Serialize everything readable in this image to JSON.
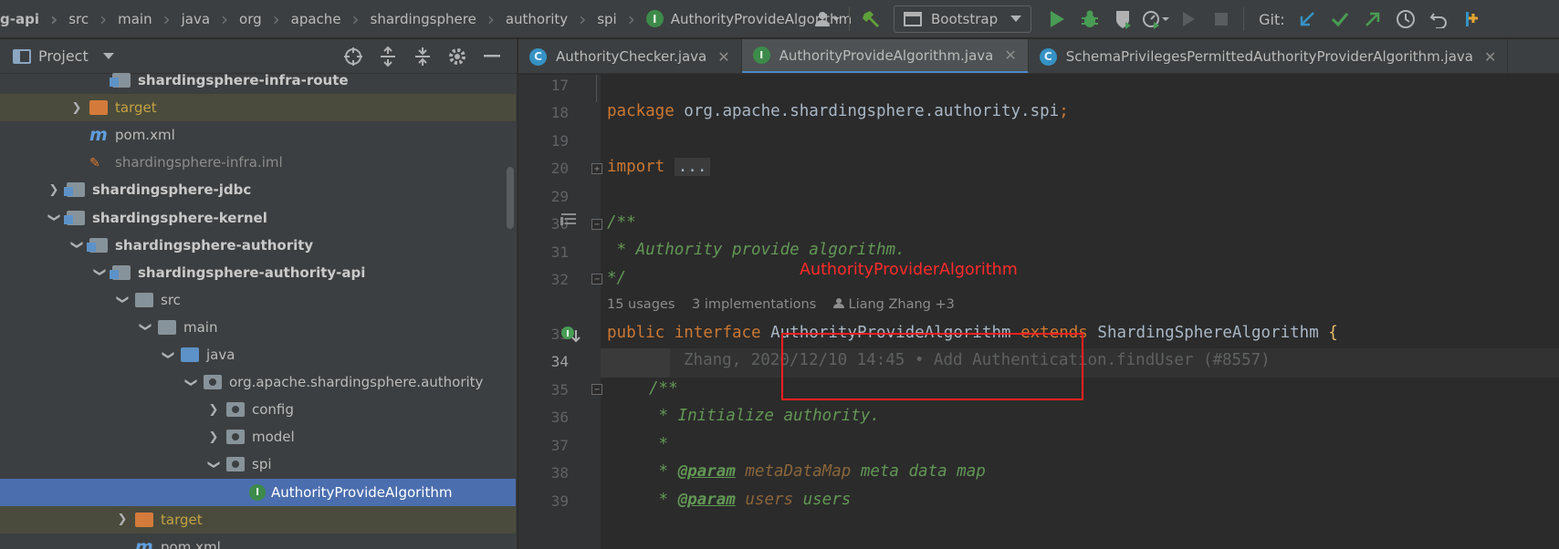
{
  "breadcrumb": {
    "items": [
      "g-api",
      "src",
      "main",
      "java",
      "org",
      "apache",
      "shardingsphere",
      "authority",
      "spi"
    ],
    "current": "AuthorityProvideAlgorithm",
    "current_badge": "I"
  },
  "toolbar": {
    "run_config": "Bootstrap",
    "git_label": "Git:"
  },
  "project_panel": {
    "title": "Project",
    "tree": [
      {
        "label": "shardingsphere-infra-route",
        "kind": "module",
        "depth": 3,
        "arrow": "",
        "style": "bold"
      },
      {
        "label": "target",
        "kind": "folder-orange",
        "depth": 2,
        "arrow": "right",
        "style": "orange"
      },
      {
        "label": "pom.xml",
        "kind": "maven",
        "depth": 2,
        "arrow": "",
        "style": ""
      },
      {
        "label": "shardingsphere-infra.iml",
        "kind": "iml",
        "depth": 2,
        "arrow": "",
        "style": "dim"
      },
      {
        "label": "shardingsphere-jdbc",
        "kind": "module",
        "depth": 1,
        "arrow": "right",
        "style": "bold"
      },
      {
        "label": "shardingsphere-kernel",
        "kind": "module",
        "depth": 1,
        "arrow": "down",
        "style": "bold"
      },
      {
        "label": "shardingsphere-authority",
        "kind": "module",
        "depth": 2,
        "arrow": "down",
        "style": "bold"
      },
      {
        "label": "shardingsphere-authority-api",
        "kind": "module",
        "depth": 3,
        "arrow": "down",
        "style": "bold"
      },
      {
        "label": "src",
        "kind": "folder",
        "depth": 4,
        "arrow": "down",
        "style": ""
      },
      {
        "label": "main",
        "kind": "folder",
        "depth": 5,
        "arrow": "down",
        "style": ""
      },
      {
        "label": "java",
        "kind": "folder-src",
        "depth": 6,
        "arrow": "down",
        "style": ""
      },
      {
        "label": "org.apache.shardingsphere.authority",
        "kind": "package",
        "depth": 7,
        "arrow": "down",
        "style": ""
      },
      {
        "label": "config",
        "kind": "package",
        "depth": 8,
        "arrow": "right",
        "style": ""
      },
      {
        "label": "model",
        "kind": "package",
        "depth": 8,
        "arrow": "right",
        "style": ""
      },
      {
        "label": "spi",
        "kind": "package",
        "depth": 8,
        "arrow": "down",
        "style": ""
      },
      {
        "label": "AuthorityProvideAlgorithm",
        "kind": "interface",
        "depth": 9,
        "arrow": "",
        "style": "selected"
      },
      {
        "label": "target",
        "kind": "folder-orange",
        "depth": 4,
        "arrow": "right",
        "style": "orange"
      },
      {
        "label": "pom.xml",
        "kind": "maven",
        "depth": 4,
        "arrow": "",
        "style": ""
      }
    ]
  },
  "tabs": [
    {
      "label": "AuthorityChecker.java",
      "badge": "C",
      "active": false
    },
    {
      "label": "AuthorityProvideAlgorithm.java",
      "badge": "I",
      "active": true
    },
    {
      "label": "SchemaPrivilegesPermittedAuthorityProviderAlgorithm.java",
      "badge": "C",
      "active": false
    }
  ],
  "editor": {
    "line_numbers": [
      "17",
      "18",
      "19",
      "20",
      "29",
      "30",
      "31",
      "32",
      "33",
      "34",
      "35",
      "36",
      "37",
      "38",
      "39"
    ],
    "code": {
      "pkg_kw": "package",
      "pkg_name": " org.apache.shardingsphere.authority.spi",
      "pkg_semi": ";",
      "import_kw": "import",
      "import_fold": "...",
      "doc_open": "/**",
      "doc_line": " * Authority provide algorithm.",
      "doc_close": "*/",
      "usages": "15 usages",
      "implementations": "3 implementations",
      "authors": "Liang Zhang +3",
      "public_kw": "public",
      "interface_kw": "interface",
      "interface_name": "AuthorityProvideAlgorithm",
      "extends_kw": "extends",
      "super_name": "ShardingSphereAlgorithm",
      "open_brace": "{",
      "blame": "Zhang, 2020/12/10 14:45 • Add Authentication.findUser (#8557)",
      "m_doc_open": "/**",
      "m_doc_line1": " * Initialize authority.",
      "m_doc_line2": " *",
      "m_doc_line3_prefix": " * ",
      "m_doc_line3_tag": "@param",
      "m_doc_line3_param": "metaDataMap",
      "m_doc_line3_rest": " meta data map",
      "m_doc_line4_prefix": " * ",
      "m_doc_line4_tag": "@param",
      "m_doc_line4_param": "users",
      "m_doc_line4_rest": " users"
    }
  },
  "annotation": {
    "text": "AuthorityProviderAlgorithm",
    "color": "#ff2a2a"
  },
  "colors": {
    "keyword": "#cc7832",
    "comment": "#629755",
    "selection": "#4b6eaf",
    "interface_badge": "#3d8b4a",
    "class_badge": "#3592c4"
  }
}
